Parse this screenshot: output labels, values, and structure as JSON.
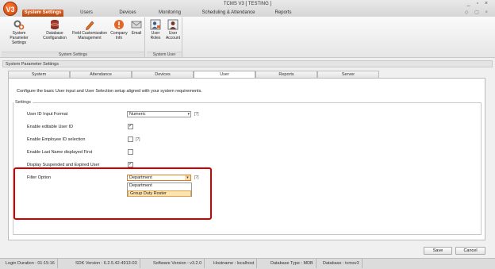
{
  "window": {
    "logo_text": "V3",
    "title": "TCMS V3 [ TESTING ]",
    "controls": [
      "_",
      "▫",
      "×"
    ],
    "small_controls": [
      "◇",
      "▢",
      "×"
    ]
  },
  "menu": {
    "tabs": [
      {
        "label": "System Settings"
      },
      {
        "label": "Users"
      },
      {
        "label": "Devices"
      },
      {
        "label": "Monitoring"
      },
      {
        "label": "Scheduling & Attendance"
      },
      {
        "label": "Reports"
      }
    ]
  },
  "ribbon": {
    "system_settings_group": "System Settings",
    "system_user_group": "System User",
    "buttons": [
      {
        "label1": "System Parameter",
        "label2": "Settings",
        "icon": "gears-icon"
      },
      {
        "label1": "Database",
        "label2": "Configuration",
        "icon": "database-icon"
      },
      {
        "label1": "Field Customization",
        "label2": "Management",
        "icon": "pencil-icon"
      },
      {
        "label1": "Company",
        "label2": "Info",
        "icon": "info-icon"
      },
      {
        "label1": "Email",
        "label2": "",
        "icon": "email-icon"
      },
      {
        "label1": "User",
        "label2": "Roles",
        "icon": "user-roles-icon"
      },
      {
        "label1": "User",
        "label2": "Account",
        "icon": "user-account-icon"
      }
    ]
  },
  "section_title": "System Parameter Settings",
  "tabs": [
    {
      "label": "System"
    },
    {
      "label": "Attendance"
    },
    {
      "label": "Devices"
    },
    {
      "label": "User"
    },
    {
      "label": "Reports"
    },
    {
      "label": "Server"
    }
  ],
  "panel": {
    "description": "Configure the basic User input and User Selection setup aligned with your system requirements.",
    "settings_label": "Settings",
    "rows": {
      "input_format_label": "User ID Input Format",
      "input_format_value": "Numeric",
      "editable_label": "Enable editable User ID",
      "employee_id_label": "Enable Employee ID selection",
      "last_name_label": "Enable Last Name displayed First",
      "suspended_label": "Display Suspended and Expired User",
      "filter_label": "Filter Option",
      "filter_value": "Department"
    },
    "checks": {
      "editable": "✓",
      "employee_id": "",
      "last_name": "",
      "suspended": "✓"
    },
    "help_mark": "[?]",
    "filter_options": [
      "Department",
      "Group Duty Roster"
    ]
  },
  "actions": {
    "save": "Save",
    "cancel": "Cancel"
  },
  "status": {
    "login_duration": "Login Duration : 01:15:16",
    "sdk_version": "SDK Version : 6.2.5.42-4913-03",
    "software_version": "Software Version : v3.2.0",
    "hostname": "Hostname : localhost",
    "database_type": "Database Type : MDB",
    "database": "Database : tcmsv3"
  },
  "colors": {
    "accent": "#c9531a",
    "highlight_box": "#d40000",
    "dropdown_hover": "#fde3b2"
  }
}
